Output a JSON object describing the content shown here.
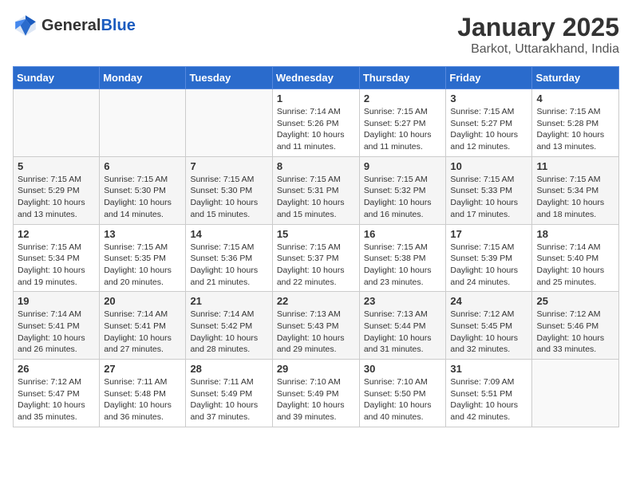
{
  "header": {
    "logo_general": "General",
    "logo_blue": "Blue",
    "month": "January 2025",
    "location": "Barkot, Uttarakhand, India"
  },
  "weekdays": [
    "Sunday",
    "Monday",
    "Tuesday",
    "Wednesday",
    "Thursday",
    "Friday",
    "Saturday"
  ],
  "weeks": [
    [
      {
        "day": "",
        "info": ""
      },
      {
        "day": "",
        "info": ""
      },
      {
        "day": "",
        "info": ""
      },
      {
        "day": "1",
        "info": "Sunrise: 7:14 AM\nSunset: 5:26 PM\nDaylight: 10 hours\nand 11 minutes."
      },
      {
        "day": "2",
        "info": "Sunrise: 7:15 AM\nSunset: 5:27 PM\nDaylight: 10 hours\nand 11 minutes."
      },
      {
        "day": "3",
        "info": "Sunrise: 7:15 AM\nSunset: 5:27 PM\nDaylight: 10 hours\nand 12 minutes."
      },
      {
        "day": "4",
        "info": "Sunrise: 7:15 AM\nSunset: 5:28 PM\nDaylight: 10 hours\nand 13 minutes."
      }
    ],
    [
      {
        "day": "5",
        "info": "Sunrise: 7:15 AM\nSunset: 5:29 PM\nDaylight: 10 hours\nand 13 minutes."
      },
      {
        "day": "6",
        "info": "Sunrise: 7:15 AM\nSunset: 5:30 PM\nDaylight: 10 hours\nand 14 minutes."
      },
      {
        "day": "7",
        "info": "Sunrise: 7:15 AM\nSunset: 5:30 PM\nDaylight: 10 hours\nand 15 minutes."
      },
      {
        "day": "8",
        "info": "Sunrise: 7:15 AM\nSunset: 5:31 PM\nDaylight: 10 hours\nand 15 minutes."
      },
      {
        "day": "9",
        "info": "Sunrise: 7:15 AM\nSunset: 5:32 PM\nDaylight: 10 hours\nand 16 minutes."
      },
      {
        "day": "10",
        "info": "Sunrise: 7:15 AM\nSunset: 5:33 PM\nDaylight: 10 hours\nand 17 minutes."
      },
      {
        "day": "11",
        "info": "Sunrise: 7:15 AM\nSunset: 5:34 PM\nDaylight: 10 hours\nand 18 minutes."
      }
    ],
    [
      {
        "day": "12",
        "info": "Sunrise: 7:15 AM\nSunset: 5:34 PM\nDaylight: 10 hours\nand 19 minutes."
      },
      {
        "day": "13",
        "info": "Sunrise: 7:15 AM\nSunset: 5:35 PM\nDaylight: 10 hours\nand 20 minutes."
      },
      {
        "day": "14",
        "info": "Sunrise: 7:15 AM\nSunset: 5:36 PM\nDaylight: 10 hours\nand 21 minutes."
      },
      {
        "day": "15",
        "info": "Sunrise: 7:15 AM\nSunset: 5:37 PM\nDaylight: 10 hours\nand 22 minutes."
      },
      {
        "day": "16",
        "info": "Sunrise: 7:15 AM\nSunset: 5:38 PM\nDaylight: 10 hours\nand 23 minutes."
      },
      {
        "day": "17",
        "info": "Sunrise: 7:15 AM\nSunset: 5:39 PM\nDaylight: 10 hours\nand 24 minutes."
      },
      {
        "day": "18",
        "info": "Sunrise: 7:14 AM\nSunset: 5:40 PM\nDaylight: 10 hours\nand 25 minutes."
      }
    ],
    [
      {
        "day": "19",
        "info": "Sunrise: 7:14 AM\nSunset: 5:41 PM\nDaylight: 10 hours\nand 26 minutes."
      },
      {
        "day": "20",
        "info": "Sunrise: 7:14 AM\nSunset: 5:41 PM\nDaylight: 10 hours\nand 27 minutes."
      },
      {
        "day": "21",
        "info": "Sunrise: 7:14 AM\nSunset: 5:42 PM\nDaylight: 10 hours\nand 28 minutes."
      },
      {
        "day": "22",
        "info": "Sunrise: 7:13 AM\nSunset: 5:43 PM\nDaylight: 10 hours\nand 29 minutes."
      },
      {
        "day": "23",
        "info": "Sunrise: 7:13 AM\nSunset: 5:44 PM\nDaylight: 10 hours\nand 31 minutes."
      },
      {
        "day": "24",
        "info": "Sunrise: 7:12 AM\nSunset: 5:45 PM\nDaylight: 10 hours\nand 32 minutes."
      },
      {
        "day": "25",
        "info": "Sunrise: 7:12 AM\nSunset: 5:46 PM\nDaylight: 10 hours\nand 33 minutes."
      }
    ],
    [
      {
        "day": "26",
        "info": "Sunrise: 7:12 AM\nSunset: 5:47 PM\nDaylight: 10 hours\nand 35 minutes."
      },
      {
        "day": "27",
        "info": "Sunrise: 7:11 AM\nSunset: 5:48 PM\nDaylight: 10 hours\nand 36 minutes."
      },
      {
        "day": "28",
        "info": "Sunrise: 7:11 AM\nSunset: 5:49 PM\nDaylight: 10 hours\nand 37 minutes."
      },
      {
        "day": "29",
        "info": "Sunrise: 7:10 AM\nSunset: 5:49 PM\nDaylight: 10 hours\nand 39 minutes."
      },
      {
        "day": "30",
        "info": "Sunrise: 7:10 AM\nSunset: 5:50 PM\nDaylight: 10 hours\nand 40 minutes."
      },
      {
        "day": "31",
        "info": "Sunrise: 7:09 AM\nSunset: 5:51 PM\nDaylight: 10 hours\nand 42 minutes."
      },
      {
        "day": "",
        "info": ""
      }
    ]
  ]
}
